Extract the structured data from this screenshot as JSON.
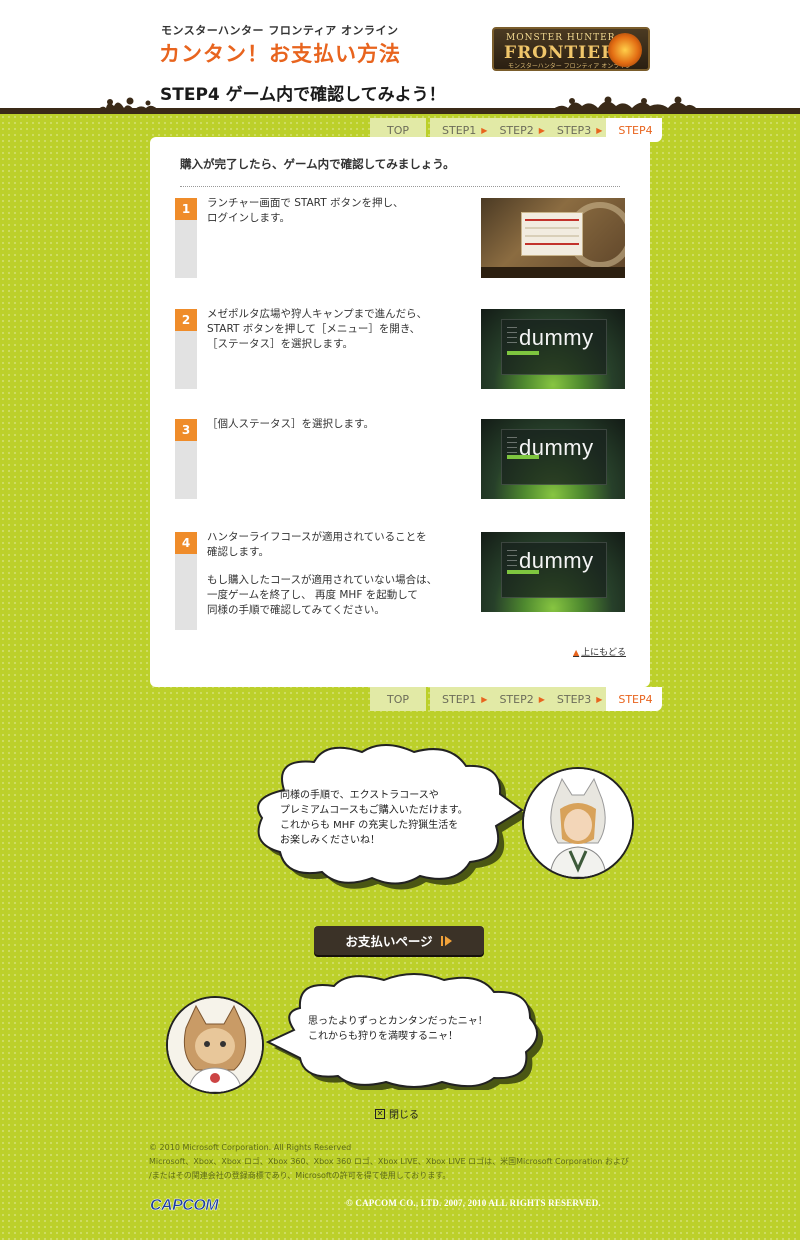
{
  "header": {
    "site_name": "モンスターハンター フロンティア オンライン",
    "title": "カンタン！お支払い方法",
    "step_title": "STEP4 ゲーム内で確認してみよう！",
    "logo": {
      "line1": "MONSTER HUNTER",
      "line2": "FRONTIER",
      "line3": "モンスターハンター フロンティア オンライン"
    }
  },
  "nav": {
    "top": "TOP",
    "steps": [
      "STEP1",
      "STEP2",
      "STEP3"
    ],
    "current": "STEP4"
  },
  "panel": {
    "intro": "購入が完了したら、ゲーム内で確認してみましょう。",
    "steps": [
      {
        "num": "1",
        "text": "ランチャー画面で START ボタンを押し、\nログインします。",
        "note": ""
      },
      {
        "num": "2",
        "text": "メゼポルタ広場や狩人キャンプまで進んだら、\nSTART ボタンを押して［メニュー］を開き、\n［ステータス］を選択します。",
        "note": ""
      },
      {
        "num": "3",
        "text": "［個人ステータス］を選択します。",
        "note": ""
      },
      {
        "num": "4",
        "text": "ハンターライフコースが適用されていることを\n確認します。",
        "note": "もし購入したコースが適用されていない場合は、\n一度ゲームを終了し、 再度 MHF を起動して\n同様の手順で確認してみてください。"
      }
    ],
    "dummy_label": "dummy",
    "back_to_top": "上にもどる"
  },
  "bubble1": "同様の手順で、エクストラコースや\nプレミアムコースもご購入いただけます。\nこれからも MHF の充実した狩猟生活を\nお楽しみくださいね！",
  "pay_button": "お支払いページ",
  "bubble2": "思ったよりずっとカンタンだったニャ！\nこれからも狩りを満喫するニャ！",
  "close": "閉じる",
  "footer": {
    "ms_copyright": "© 2010 Microsoft Corporation. All Rights Reserved\nMicrosoft、Xbox、Xbox ロゴ、Xbox 360、Xbox 360 ロゴ、Xbox LIVE、Xbox LIVE ロゴは、米国Microsoft Corporation および\n/またはその関連会社の登録商標であり、Microsoftの許可を得て使用しております。",
    "capcom_logo": "CAPCOM",
    "capcom_copyright": "© CAPCOM CO., LTD. 2007, 2010 ALL RIGHTS RESERVED."
  },
  "colors": {
    "background": "#bcd02a",
    "accent": "#e8641e",
    "badge": "#ef8c2a",
    "dark": "#3b3227"
  }
}
